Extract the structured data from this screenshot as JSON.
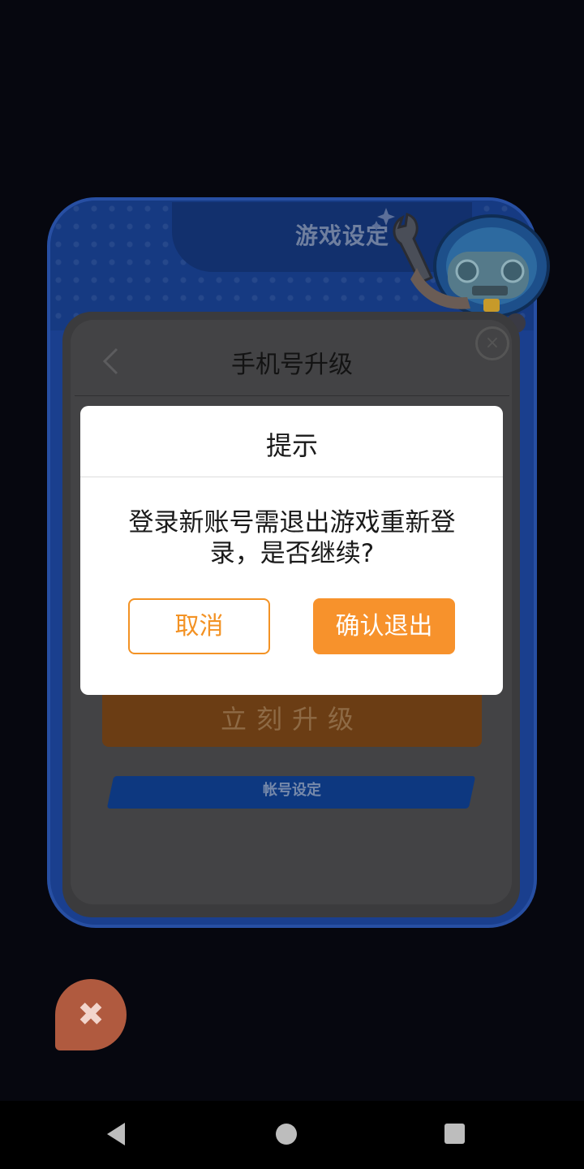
{
  "game_panel": {
    "title": "游戏设定",
    "mascot_icon": "robot-mechanic-icon"
  },
  "upgrade_card": {
    "title": "手机号升级",
    "back_icon": "chevron-left-icon",
    "close_icon": "close-circle-icon",
    "close_glyph": "×",
    "upgrade_button_label": "立刻升级",
    "account_settings_label": "帐号设定"
  },
  "dialog": {
    "title": "提示",
    "message": "登录新账号需退出游戏重新登录，是否继续?",
    "cancel_label": "取消",
    "confirm_label": "确认退出"
  },
  "floating_close": {
    "glyph": "✖",
    "icon": "close-icon"
  },
  "nav_bar": {
    "back_icon": "nav-back-icon",
    "home_icon": "nav-home-icon",
    "recent_icon": "nav-recent-apps-icon"
  },
  "colors": {
    "accent": "#f7922c",
    "panel_blue": "#1a3f8e",
    "overlay_bg": "#06070f"
  }
}
